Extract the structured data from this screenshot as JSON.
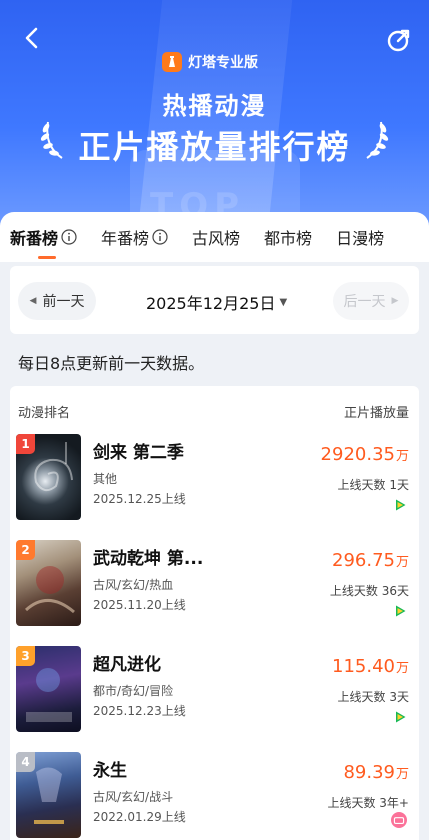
{
  "header": {
    "brand": "灯塔专业版",
    "title1": "热播动漫",
    "title2": "正片播放量排行榜",
    "bg_text": "TOP"
  },
  "tabs": [
    {
      "label": "新番榜",
      "active": true,
      "info": true
    },
    {
      "label": "年番榜",
      "active": false,
      "info": true
    },
    {
      "label": "古风榜",
      "active": false,
      "info": false
    },
    {
      "label": "都市榜",
      "active": false,
      "info": false
    },
    {
      "label": "日漫榜",
      "active": false,
      "info": false
    }
  ],
  "date_bar": {
    "prev": "前一天",
    "date": "2025年12月25日",
    "next": "后一天"
  },
  "notice": "每日8点更新前一天数据。",
  "list": {
    "col_left": "动漫排名",
    "col_right": "正片播放量",
    "items": [
      {
        "rank": "1",
        "name": "剑来 第二季",
        "genre": "其他",
        "online": "2025.12.25上线",
        "plays": "2920.35",
        "unit": "万",
        "days": "上线天数 1天",
        "platform": "tencent-video-icon",
        "rank_color": "#f0463a"
      },
      {
        "rank": "2",
        "name": "武动乾坤 第...",
        "genre": "古风/玄幻/热血",
        "online": "2025.11.20上线",
        "plays": "296.75",
        "unit": "万",
        "days": "上线天数 36天",
        "platform": "tencent-video-icon",
        "rank_color": "#ff7a2e"
      },
      {
        "rank": "3",
        "name": "超凡进化",
        "genre": "都市/奇幻/冒险",
        "online": "2025.12.23上线",
        "plays": "115.40",
        "unit": "万",
        "days": "上线天数 3天",
        "platform": "tencent-video-icon",
        "rank_color": "#ffa12b"
      },
      {
        "rank": "4",
        "name": "永生",
        "genre": "古风/玄幻/战斗",
        "online": "2022.01.29上线",
        "plays": "89.39",
        "unit": "万",
        "days": "上线天数 3年+",
        "platform": "bilibili-icon",
        "rank_color": "#b9bdc6"
      }
    ]
  },
  "colors": {
    "accent": "#ff5b1f",
    "header_blue": "#3f78ff"
  }
}
